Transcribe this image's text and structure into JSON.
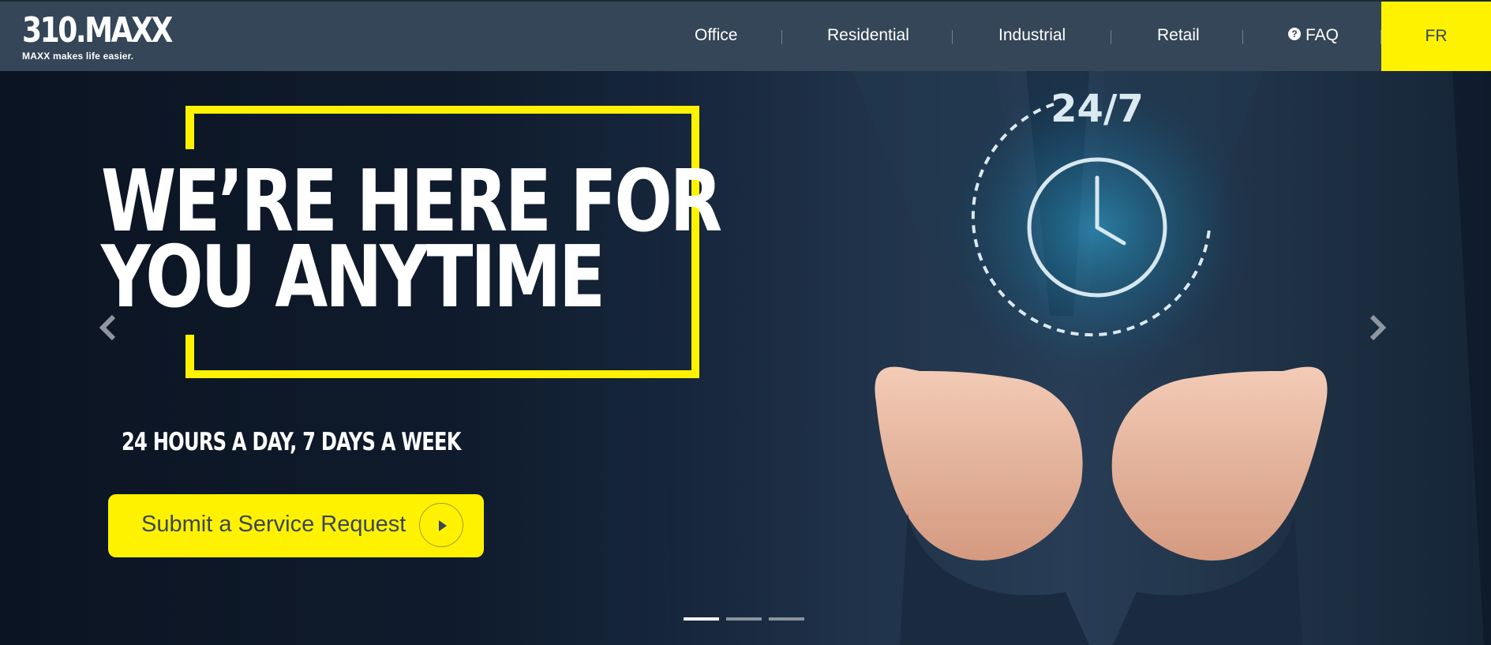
{
  "header": {
    "logo_title": "310.MAXX",
    "logo_tagline": "MAXX makes life easier.",
    "nav": [
      {
        "label": "Office"
      },
      {
        "label": "Residential"
      },
      {
        "label": "Industrial"
      },
      {
        "label": "Retail"
      },
      {
        "label": "FAQ",
        "icon": "question-circle-icon"
      }
    ],
    "language_button": "FR"
  },
  "hero": {
    "headline_line1": "WE’RE HERE FOR",
    "headline_line2": "YOU ANYTIME",
    "subheadline": "24 HOURS A DAY, 7 DAYS A WEEK",
    "cta_label": "Submit a Service Request",
    "image_badge_text": "24/7",
    "carousel": {
      "slide_count": 3,
      "active_index": 0
    }
  },
  "colors": {
    "accent_yellow": "#fff200",
    "header_bg": "#344658",
    "hero_bg": "#0f1b2c"
  },
  "icons": {
    "prev": "chevron-left-icon",
    "next": "chevron-right-icon",
    "cta": "play-circle-icon",
    "faq": "question-circle-icon"
  }
}
